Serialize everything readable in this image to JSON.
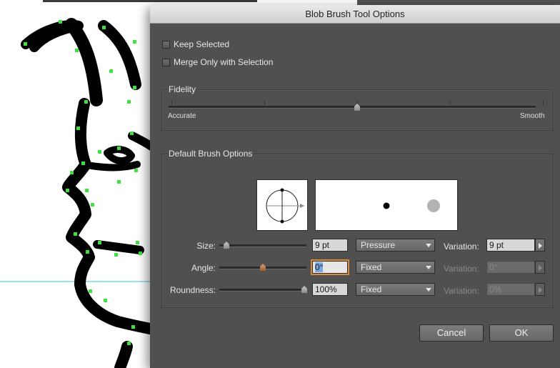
{
  "dialog": {
    "title": "Blob Brush Tool Options",
    "keep_selected": {
      "label": "Keep Selected",
      "checked": false
    },
    "merge_only": {
      "label": "Merge Only with Selection",
      "checked": false
    },
    "fidelity": {
      "title": "Fidelity",
      "left_label": "Accurate",
      "right_label": "Smooth",
      "value_fraction": 0.5
    },
    "brush": {
      "title": "Default Brush Options",
      "size": {
        "label": "Size:",
        "value": "9 pt",
        "mode": "Pressure",
        "variation_label": "Variation:",
        "variation": "9 pt",
        "slider_fraction": 0.05
      },
      "angle": {
        "label": "Angle:",
        "value": "0°",
        "mode": "Fixed",
        "variation_label": "Variation:",
        "variation": "0°",
        "slider_fraction": 0.5
      },
      "roundness": {
        "label": "Roundness:",
        "value": "100%",
        "mode": "Fixed",
        "variation_label": "Variation:",
        "variation": "0%",
        "slider_fraction": 1.0
      }
    },
    "cancel_label": "Cancel",
    "ok_label": "OK"
  },
  "colors": {
    "dialog_bg": "#505050",
    "anchor_points": "#40e040",
    "guide_line": "#3ac8d8",
    "focus_ring": "#d98a3a"
  }
}
